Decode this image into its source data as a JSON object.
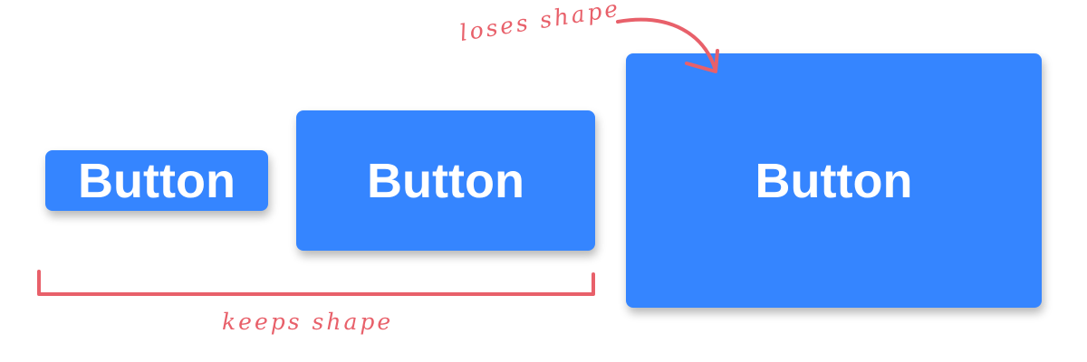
{
  "buttons": {
    "small_label": "Button",
    "medium_label": "Button",
    "large_label": "Button"
  },
  "annotations": {
    "loses_shape": "loses shape",
    "keeps_shape": "keeps shape"
  },
  "colors": {
    "button_fill": "#3585ff",
    "button_text": "#ffffff",
    "annotation": "#e8606a",
    "background": "#ffffff"
  }
}
